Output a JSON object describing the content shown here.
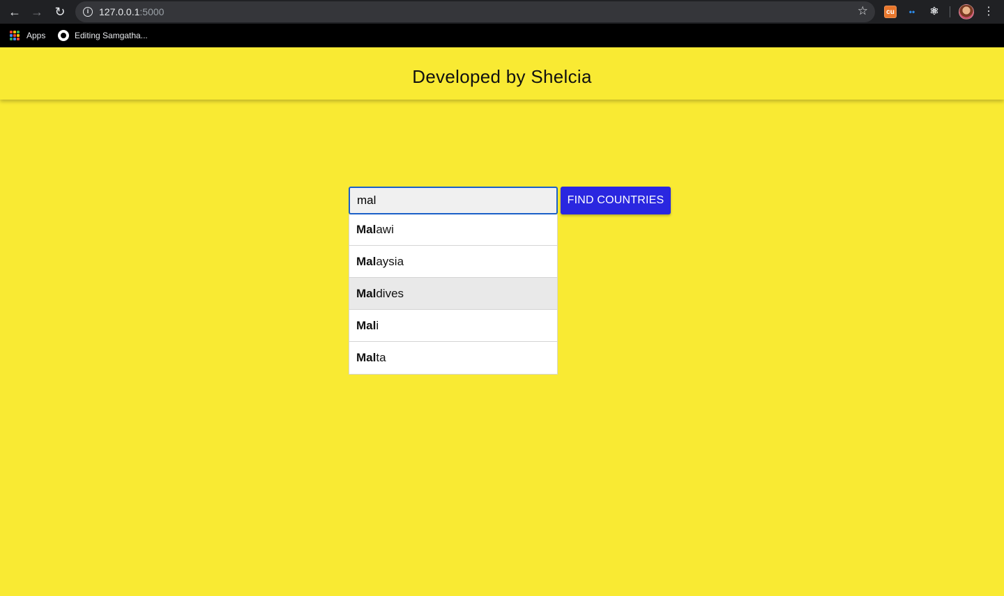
{
  "browser": {
    "url_host": "127.0.0.1",
    "url_port": ":5000",
    "bookmarks": [
      {
        "label": "Apps"
      },
      {
        "label": "Editing Samgatha..."
      }
    ],
    "extensions": {
      "cu_label": "cu"
    },
    "icons": [
      "back-arrow-icon",
      "forward-arrow-icon",
      "reload-icon",
      "info-icon",
      "star-icon",
      "apps-grid-icon",
      "github-icon",
      "extension-cu-icon",
      "extension-code-icon",
      "react-icon",
      "avatar",
      "kebab-menu-icon"
    ]
  },
  "header": {
    "title": "Developed by Shelcia"
  },
  "search": {
    "value": "mal",
    "button_label": "FIND COUNTRIES",
    "suggestions": [
      {
        "match": "Mal",
        "rest": "awi"
      },
      {
        "match": "Mal",
        "rest": "aysia"
      },
      {
        "match": "Mal",
        "rest": "dives"
      },
      {
        "match": "Mal",
        "rest": "i"
      },
      {
        "match": "Mal",
        "rest": "ta"
      }
    ],
    "highlighted_suggestion": "Maldives"
  },
  "colors": {
    "page_background": "#f9ea33",
    "button_background": "#2a27e0",
    "input_focus_border": "#1a5fc8",
    "suggestion_highlight": "#e9e9e9"
  }
}
